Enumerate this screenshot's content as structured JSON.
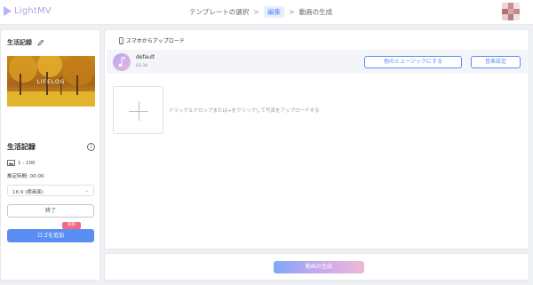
{
  "app": {
    "logo_text": "LightMV"
  },
  "steps": [
    {
      "label": "テンプレートの選択"
    },
    {
      "label": "編集"
    },
    {
      "label": "動画の生成"
    }
  ],
  "colors": {
    "accent": "#5b8ef5",
    "paid_badge": "#f26a85",
    "logo": "#b59ce8"
  },
  "left_panel": {
    "project_title": "生活記録",
    "thumbnail_text": "LIFELOG",
    "template_name": "生活記録",
    "image_count": "1 - 100",
    "duration": "推定時間: 00:00",
    "ratio_selected": "16:9 (横画面)",
    "finish_label": "終了",
    "paid_badge": "有料",
    "add_logo_label": "ロゴを追加"
  },
  "main": {
    "phone_upload_label": "スマホからアップロード",
    "music": {
      "name": "default",
      "time": "02:34",
      "other_music_label": "他のミュージックにする",
      "settings_label": "音楽設定"
    },
    "drop_text": "ドラッグ＆ドロップまたは+をクリックして写真をアップロードする"
  },
  "bottom": {
    "generate_label": "動画の生成"
  }
}
